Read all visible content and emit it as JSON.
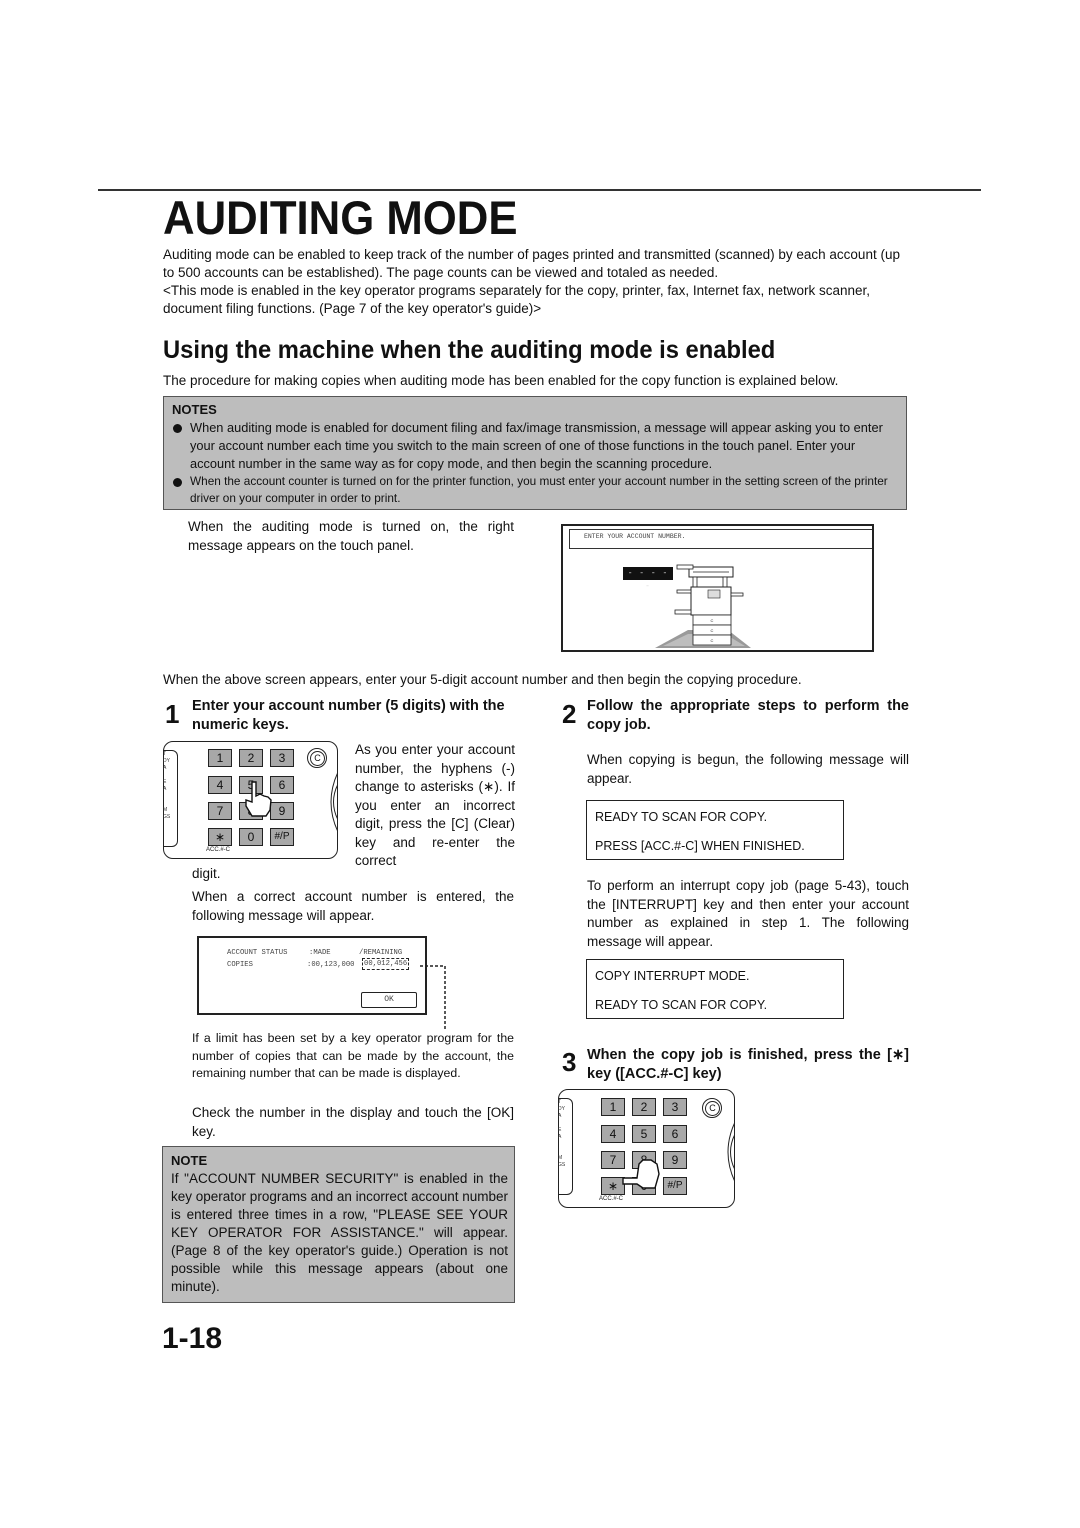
{
  "title": "AUDITING MODE",
  "intro": {
    "paragraph1": "Auditing mode can be enabled to keep track of the number of pages printed and transmitted (scanned) by each account (up to 500 accounts can be established). The page counts can be viewed and totaled as needed.",
    "paragraph2": "<This mode is enabled in the key operator programs separately for the copy, printer, fax, Internet fax, network scanner, document filing functions. (Page 7 of the key operator's guide)>"
  },
  "section": {
    "heading": "Using the machine when the auditing mode is enabled",
    "lead": "The procedure for making copies when auditing mode has been enabled for the copy function is explained below."
  },
  "notes": {
    "title": "NOTES",
    "items": [
      "When auditing mode is enabled for document filing and fax/image transmission, a message will appear asking you to enter your account number each time you switch to the main screen of one of those functions in the touch panel. Enter your account number in the same way as for copy mode, and then begin the scanning procedure.",
      "When the account counter is turned on for the printer function, you must enter your account number in the setting screen of the printer driver on your computer in order to print."
    ]
  },
  "touch_panel_intro": "When the auditing mode is turned on, the right message appears on the touch panel.",
  "touch_panel": {
    "message": "ENTER YOUR ACCOUNT NUMBER.",
    "entry_field": "- - - - -",
    "tray_labels": [
      "C",
      "C",
      "C"
    ]
  },
  "after_screen": "When the above screen appears, enter your 5-digit account number and then begin the copying procedure.",
  "steps": [
    {
      "number": "1",
      "title": "Enter your account number (5 digits) with the numeric keys.",
      "body_side": "As you enter your account number, the hyphens (-) change to asterisks (∗). If you enter an incorrect digit, press the [C] (Clear) key and re-enter the correct",
      "body_tail": "digit.",
      "body2": "When a correct account number is entered, the following message will appear.",
      "account_status": {
        "header_label": "ACCOUNT STATUS",
        "made_label": ":MADE",
        "remaining_label": "/REMAINING",
        "row_label": "COPIES",
        "made_value": ":00,123,000",
        "remaining_value": "00,012,456",
        "ok_label": "OK"
      },
      "limit_note": "If a limit has been set by a key operator program for the number of copies that can be made by the account, the remaining number that can be made is displayed.",
      "check_text": "Check the number in the display and touch the [OK] key."
    },
    {
      "number": "2",
      "title": "Follow the appropriate steps to perform the copy job.",
      "body": "When copying is begun, the following message will appear.",
      "message_lines": [
        "READY TO SCAN FOR COPY.",
        "PRESS [ACC.#-C] WHEN FINISHED."
      ],
      "interrupt_text": "To perform an interrupt copy job (page 5-43), touch the [INTERRUPT] key and then enter your account number as explained in step 1. The following message will appear.",
      "interrupt_lines": [
        "COPY INTERRUPT MODE.",
        "READY TO SCAN FOR COPY."
      ]
    },
    {
      "number": "3",
      "title": "When the copy job is finished, press the [∗] key ([ACC.#-C] key)"
    }
  ],
  "keypad": {
    "keys": [
      "1",
      "2",
      "3",
      "4",
      "5",
      "6",
      "7",
      "8",
      "9",
      "∗",
      "0",
      "#/P"
    ],
    "clear_key": "C",
    "acc_label": "ACC.#-C",
    "side_labels": "T\nDY\nA\n\nE\nA\n\n\nM\nGS"
  },
  "note": {
    "title": "NOTE",
    "body": "If \"ACCOUNT NUMBER SECURITY\" is enabled in the key operator programs and an incorrect account number is entered three times in a row, \"PLEASE SEE YOUR KEY OPERATOR FOR ASSISTANCE.\" will appear. (Page 8 of the key operator's guide.) Operation is not possible while this message appears (about one minute)."
  },
  "page_number": "1-18"
}
